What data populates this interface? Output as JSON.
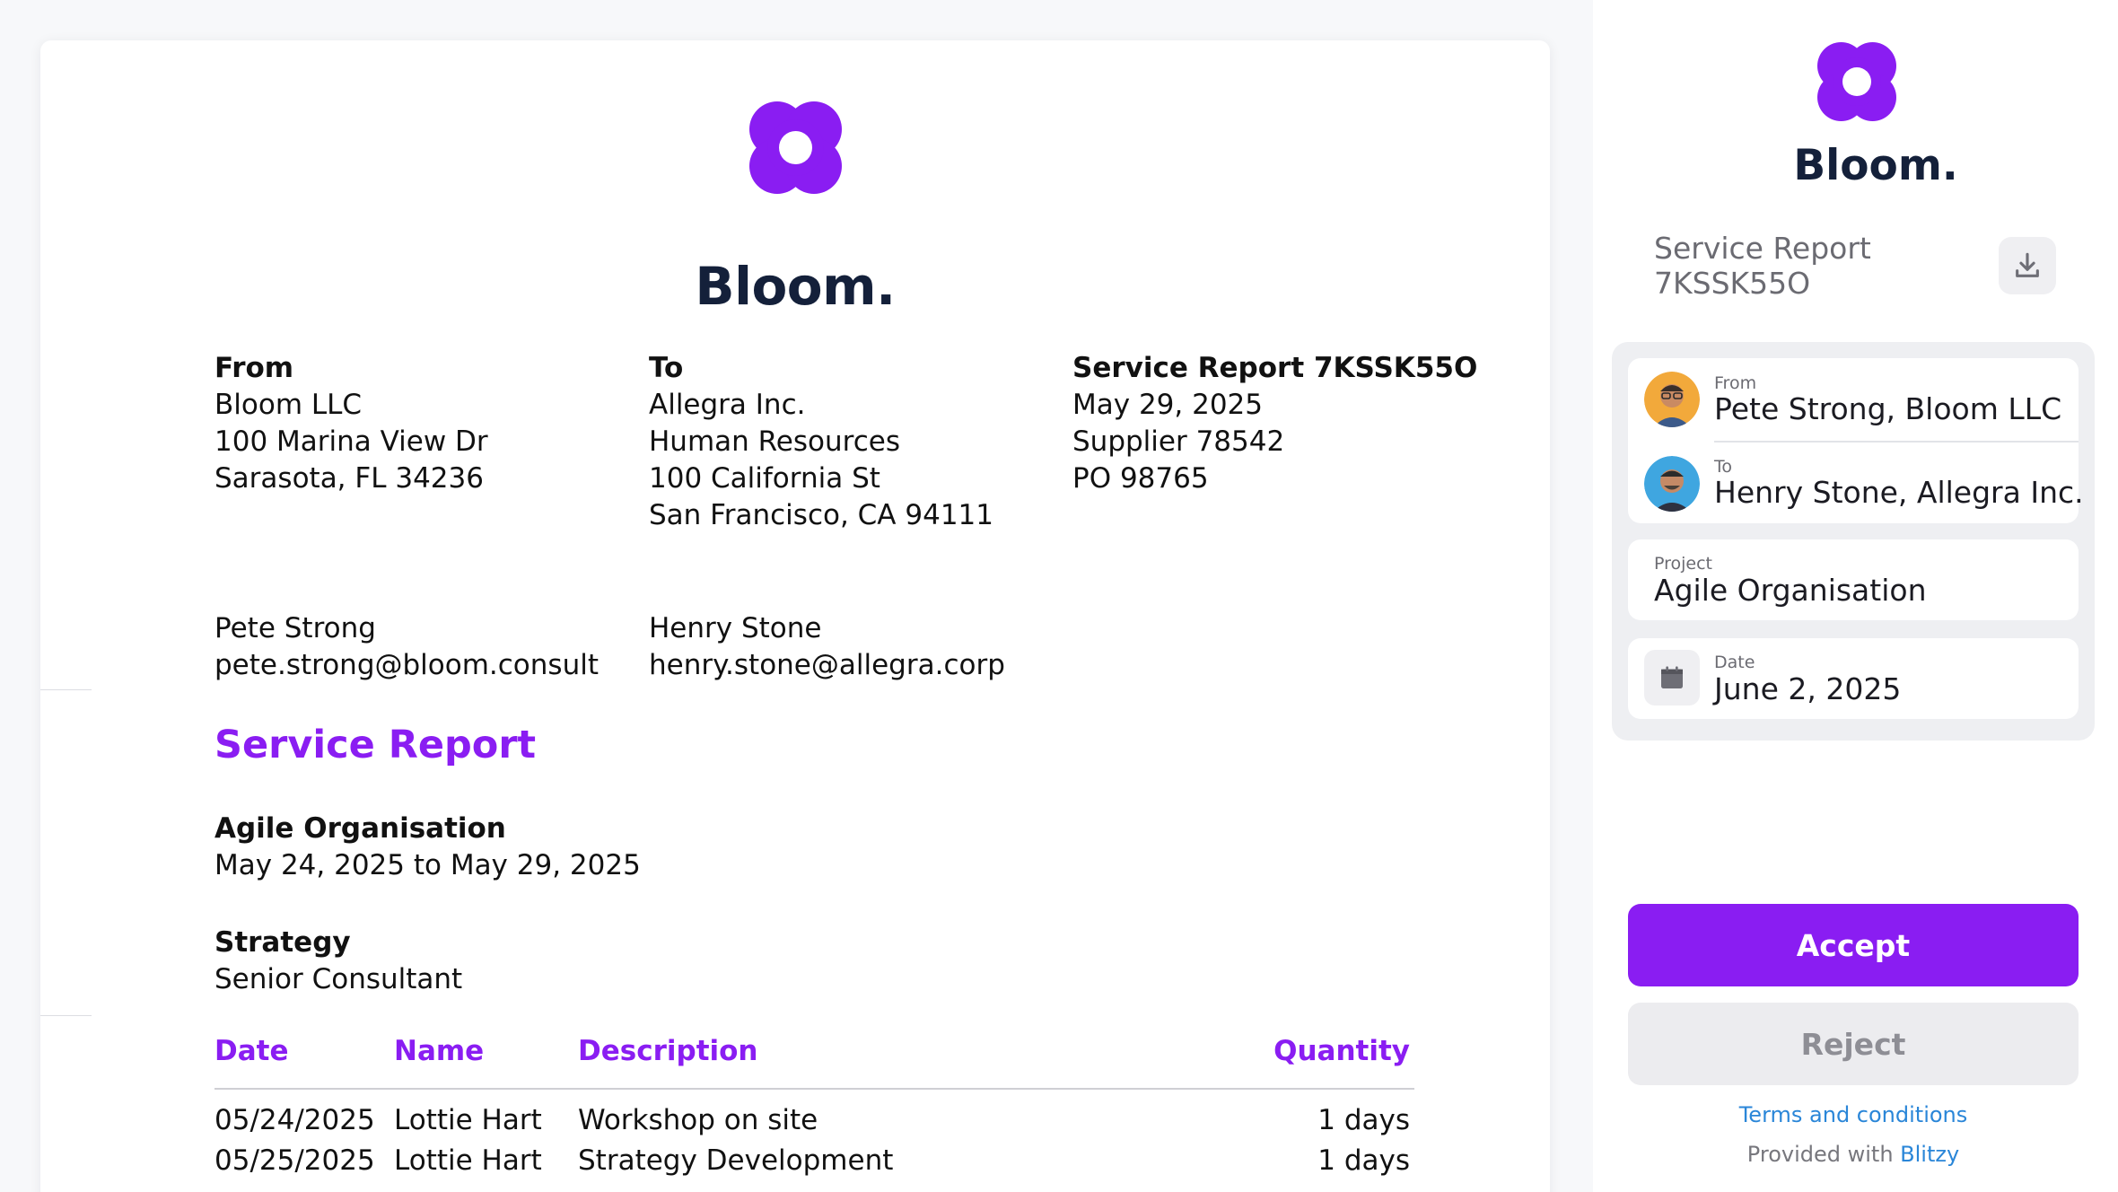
{
  "brand": {
    "name": "Bloom.",
    "color": "#8a1df2",
    "text_color": "#14203a"
  },
  "document": {
    "from": {
      "heading": "From",
      "lines": [
        "Bloom LLC",
        "100 Marina View Dr",
        "Sarasota, FL 34236"
      ],
      "contact_name": "Pete Strong",
      "contact_email": "pete.strong@bloom.consult"
    },
    "to": {
      "heading": "To",
      "lines": [
        "Allegra Inc.",
        "Human Resources",
        "100 California St",
        "San Francisco, CA 94111"
      ],
      "contact_name": "Henry Stone",
      "contact_email": "henry.stone@allegra.corp"
    },
    "report": {
      "heading": "Service Report 7KSSK55O",
      "lines": [
        "May 29, 2025",
        "Supplier 78542",
        "PO 98765"
      ]
    },
    "section_title": "Service Report",
    "project": {
      "name": "Agile Organisation",
      "period": "May 24, 2025 to May 29, 2025"
    },
    "role": {
      "name": "Strategy",
      "title": "Senior Consultant"
    },
    "table": {
      "headers": {
        "date": "Date",
        "name": "Name",
        "description": "Description",
        "quantity": "Quantity"
      },
      "rows": [
        {
          "date": "05/24/2025",
          "name": "Lottie Hart",
          "description": "Workshop on site",
          "quantity": "1 days"
        },
        {
          "date": "05/25/2025",
          "name": "Lottie Hart",
          "description": "Strategy Development",
          "quantity": "1 days"
        }
      ]
    }
  },
  "sidebar": {
    "report_label": "Service Report",
    "report_id": "7KSSK55O",
    "download_icon": "download-icon",
    "from": {
      "label": "From",
      "value": "Pete Strong, Bloom LLC"
    },
    "to": {
      "label": "To",
      "value": "Henry Stone, Allegra Inc."
    },
    "project": {
      "label": "Project",
      "value": "Agile Organisation"
    },
    "date": {
      "label": "Date",
      "value": "June 2, 2025",
      "icon": "calendar-icon"
    },
    "accept_label": "Accept",
    "reject_label": "Reject",
    "terms_label": "Terms and conditions",
    "provided_label": "Provided with",
    "provider_name": "Blitzy",
    "link_color": "#2a86d8"
  }
}
